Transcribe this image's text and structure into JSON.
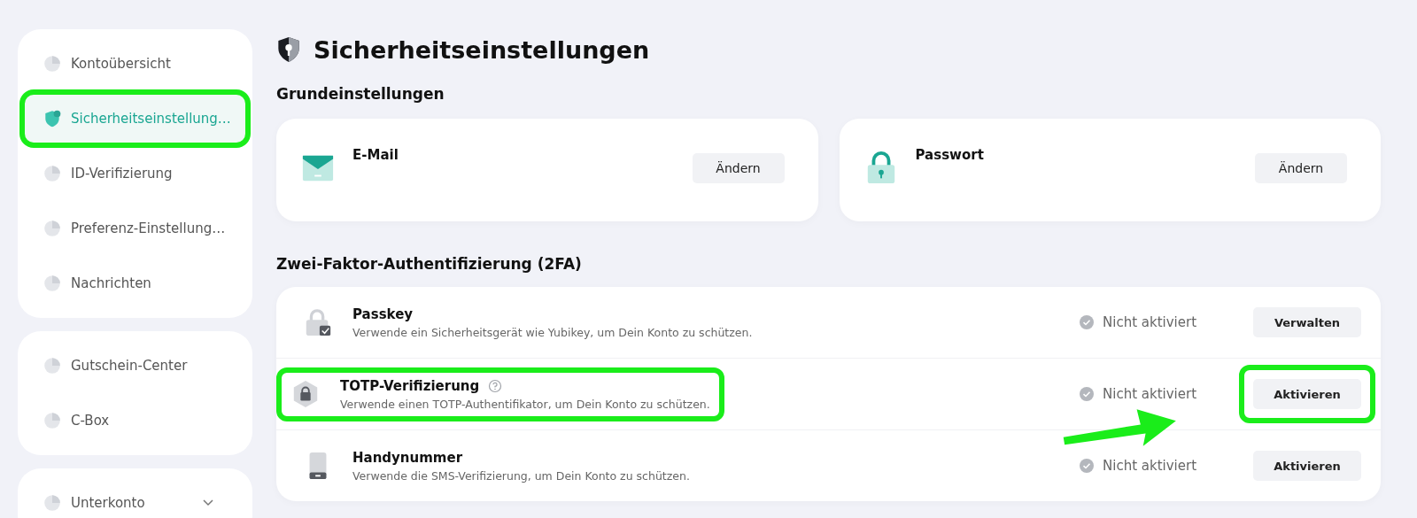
{
  "sidebar": {
    "groups": [
      {
        "items": [
          {
            "label": "Kontoübersicht",
            "selected": false,
            "highlighted": false
          },
          {
            "label": "Sicherheitseinstellung…",
            "selected": true,
            "highlighted": true
          },
          {
            "label": "ID-Verifizierung",
            "selected": false,
            "highlighted": false
          },
          {
            "label": "Preferenz-Einstellung…",
            "selected": false,
            "highlighted": false
          },
          {
            "label": "Nachrichten",
            "selected": false,
            "highlighted": false
          }
        ]
      },
      {
        "items": [
          {
            "label": "Gutschein-Center",
            "selected": false,
            "highlighted": false
          },
          {
            "label": "C-Box",
            "selected": false,
            "highlighted": false
          }
        ]
      },
      {
        "items": [
          {
            "label": "Unterkonto",
            "selected": false,
            "highlighted": false,
            "expanded": false
          }
        ]
      }
    ]
  },
  "page": {
    "title": "Sicherheitseinstellungen"
  },
  "basic": {
    "heading": "Grundeinstellungen",
    "cards": [
      {
        "title": "E-Mail",
        "button": "Ändern"
      },
      {
        "title": "Passwort",
        "button": "Ändern"
      }
    ]
  },
  "twofa": {
    "heading": "Zwei-Faktor-Authentifizierung (2FA)",
    "rows": [
      {
        "title": "Passkey",
        "description": "Verwende ein Sicherheitsgerät wie Yubikey, um Dein Konto zu schützen.",
        "help": false,
        "status": "Nicht aktiviert",
        "button": "Verwalten",
        "highlighted": false,
        "button_highlighted": false
      },
      {
        "title": "TOTP-Verifizierung",
        "description": "Verwende einen TOTP-Authentifikator, um Dein Konto zu schützen.",
        "help": true,
        "status": "Nicht aktiviert",
        "button": "Aktivieren",
        "highlighted": true,
        "button_highlighted": true
      },
      {
        "title": "Handynummer",
        "description": "Verwende die SMS-Verifizierung, um Dein Konto zu schützen.",
        "help": false,
        "status": "Nicht aktiviert",
        "button": "Aktivieren",
        "highlighted": false,
        "button_highlighted": false
      }
    ]
  },
  "annotations": {
    "arrow": true
  }
}
